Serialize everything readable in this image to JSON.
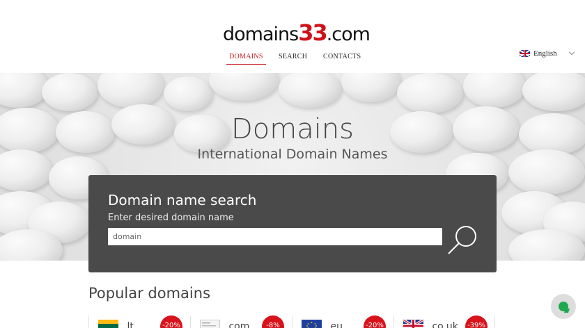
{
  "logo": {
    "text_before": "domains",
    "text_num": "33",
    "text_after": ".com"
  },
  "nav": {
    "domains": "DOMAINS",
    "search": "SEARCH",
    "contacts": "CONTACTS"
  },
  "language": {
    "label": "English",
    "flag": "uk-flag-icon"
  },
  "hero": {
    "title": "Domains",
    "subtitle": "International Domain Names"
  },
  "search": {
    "title": "Domain name search",
    "hint": "Enter desired domain name",
    "placeholder": "domain",
    "button_icon": "magnifier-icon"
  },
  "popular": {
    "title": "Popular domains",
    "items": [
      {
        "tld": ".lt",
        "discount": "-20%",
        "flag": "lithuania-flag-icon"
      },
      {
        "tld": ".com",
        "discount": "-8%",
        "flag": "other-flag-icon"
      },
      {
        "tld": ".eu",
        "discount": "-20%",
        "flag": "eu-flag-icon"
      },
      {
        "tld": ".co.uk",
        "discount": "-39%",
        "flag": "uk-flag-icon"
      }
    ]
  },
  "colors": {
    "accent": "#c8171e",
    "panel": "#4a4a4a",
    "badge": "#d9131b",
    "chat": "#1fa84f"
  }
}
